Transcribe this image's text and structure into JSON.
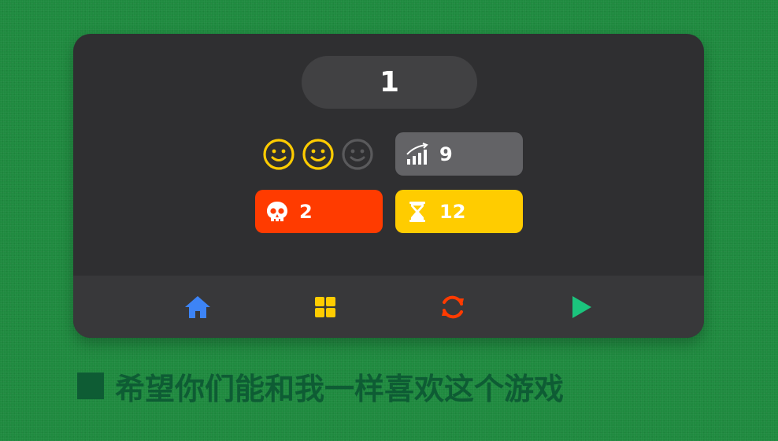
{
  "level": {
    "number": "1"
  },
  "rating": {
    "stars_earned": 2,
    "stars_total": 3
  },
  "stats": {
    "progress": {
      "icon": "signal-bars-icon",
      "value": "9",
      "color": "#636366"
    },
    "deaths": {
      "icon": "skull-icon",
      "value": "2",
      "color": "#ff3b00"
    },
    "time": {
      "icon": "hourglass-icon",
      "value": "12",
      "color": "#ffcc00"
    }
  },
  "nav": [
    {
      "id": "home",
      "icon": "home-icon",
      "color": "#3d84f6"
    },
    {
      "id": "levels",
      "icon": "grid-icon",
      "color": "#ffcc00"
    },
    {
      "id": "restart",
      "icon": "restart-icon",
      "color": "#ff3b00"
    },
    {
      "id": "next",
      "icon": "play-icon",
      "color": "#1bc47d"
    }
  ],
  "caption": {
    "text": "希望你们能和我一样喜欢这个游戏"
  },
  "colors": {
    "panel": "#2f2f31",
    "face_active": "#ffcc00",
    "face_inactive": "#5a5a5c",
    "background": "#1f8a3f"
  }
}
